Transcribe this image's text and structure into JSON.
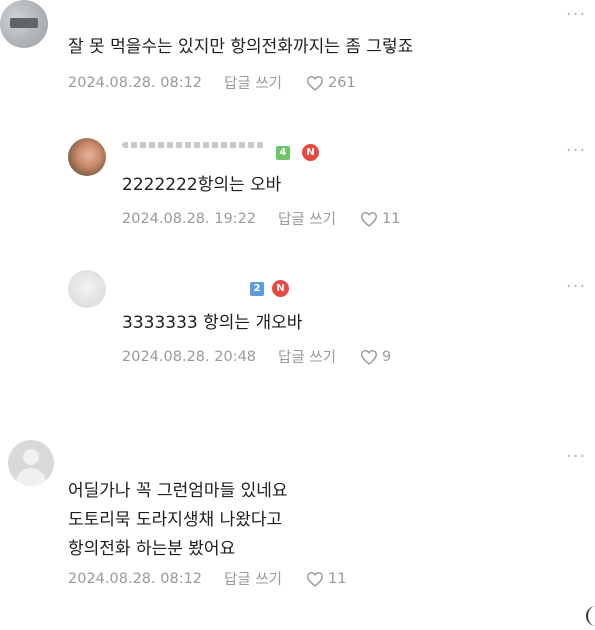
{
  "comments": [
    {
      "text_lines": [
        "잘 못 먹을수는 있지만 항의전화까지는 좀 그렇죠"
      ],
      "date": "2024.08.28. 08:12",
      "reply_label": "답글 쓰기",
      "likes": "261"
    },
    {
      "level": "4",
      "badge": "N",
      "text_lines": [
        "2222222항의는 오바"
      ],
      "date": "2024.08.28. 19:22",
      "reply_label": "답글 쓰기",
      "likes": "11"
    },
    {
      "level": "2",
      "badge": "N",
      "text_lines": [
        "3333333 항의는 개오바"
      ],
      "date": "2024.08.28. 20:48",
      "reply_label": "답글 쓰기",
      "likes": "9"
    },
    {
      "text_lines": [
        "어딜가나 꼭 그런엄마들 있네요",
        "도토리묵  도라지생채 나왔다고",
        "항의전화 하는분 봤어요"
      ],
      "date": "2024.08.28. 08:12",
      "reply_label": "답글 쓰기",
      "likes": "11"
    }
  ],
  "more_icon": "more-horizontal-icon",
  "like_icon": "heart-outline-icon",
  "colors": {
    "meta": "#9a9a9a",
    "level_green": "#6cc36c",
    "level_blue": "#5b9be0",
    "new_badge": "#e8493f"
  }
}
